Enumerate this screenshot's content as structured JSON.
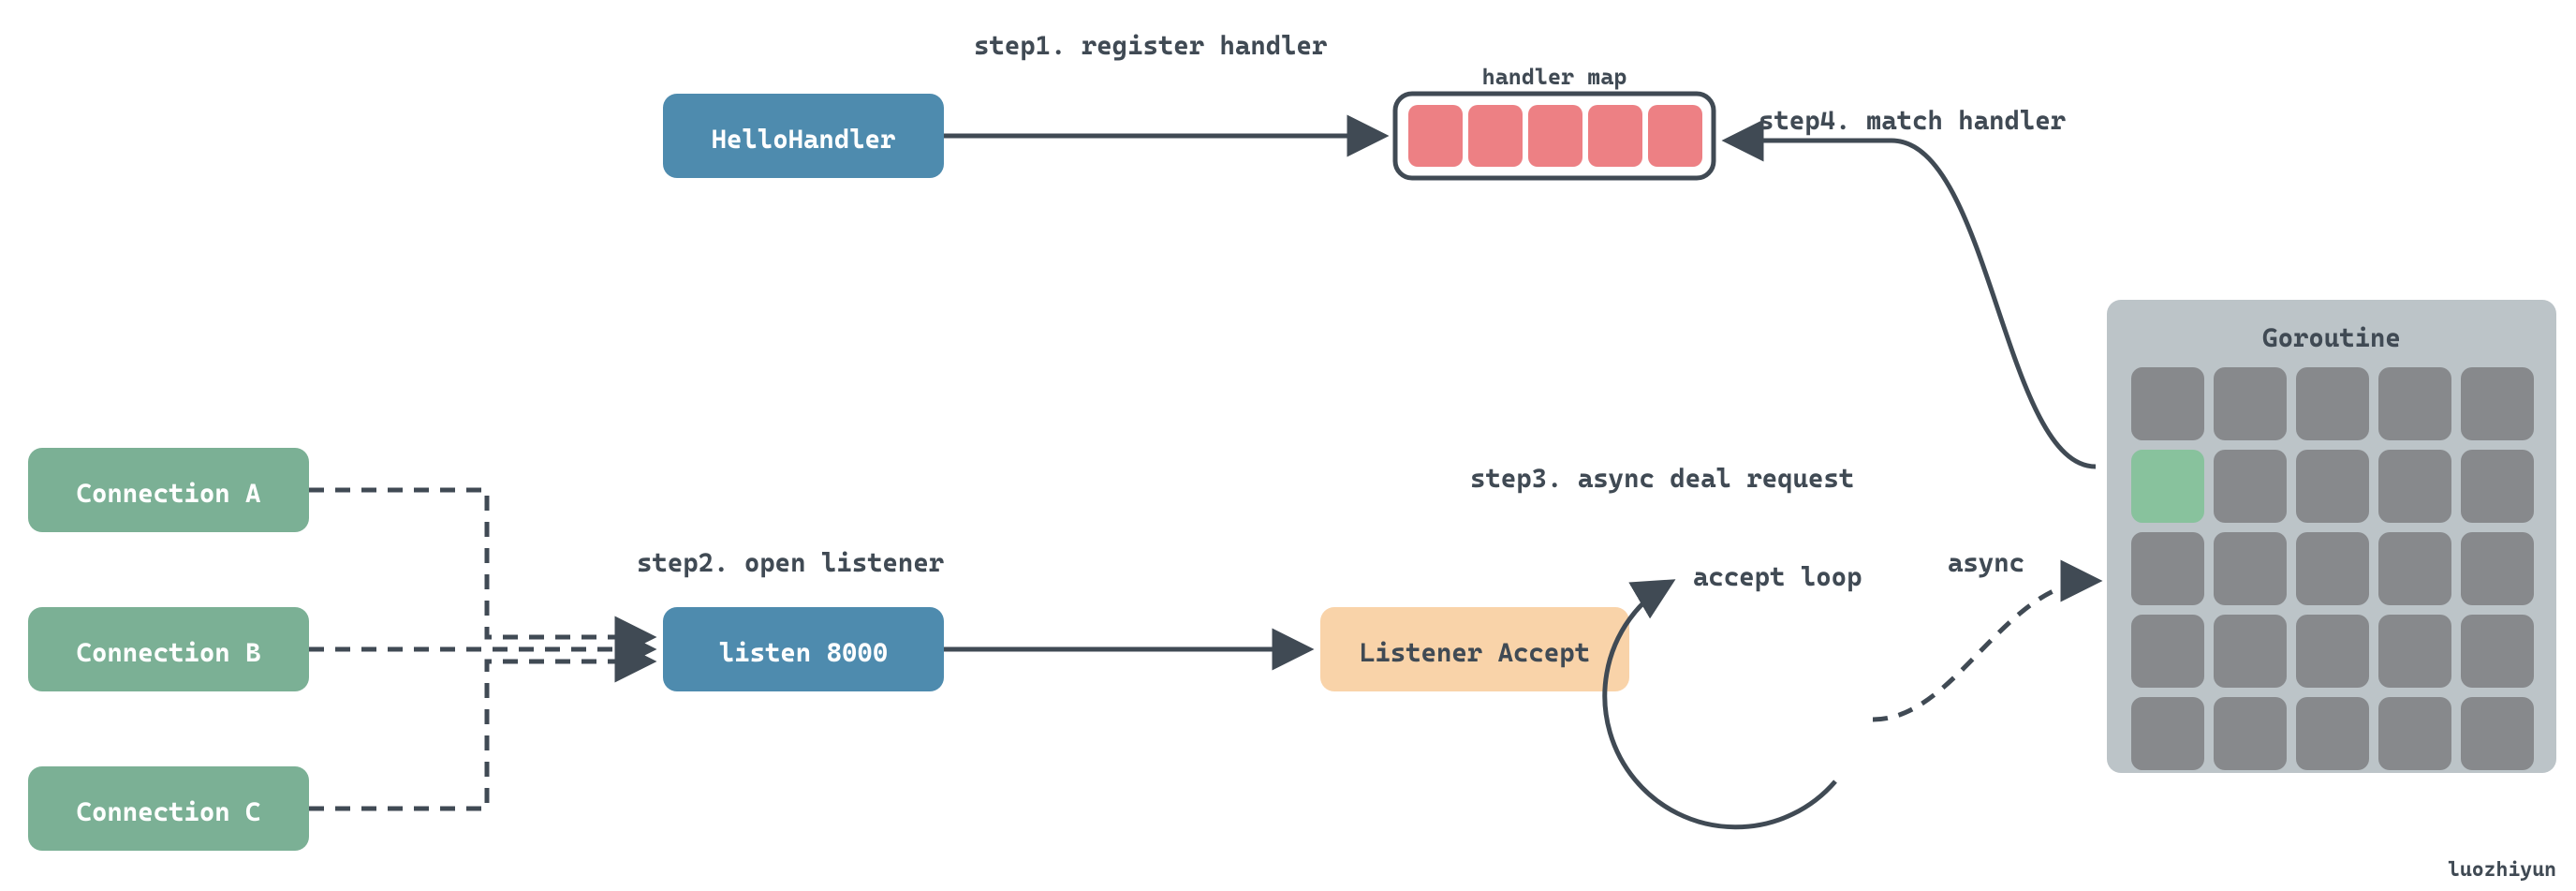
{
  "steps": {
    "s1": "step1. register handler",
    "s2": "step2. open listener",
    "s3": "step3. async deal request",
    "s4": "step4. match handler"
  },
  "boxes": {
    "hello_handler": "HelloHandler",
    "handler_map_label": "handler map",
    "conn_a": "Connection A",
    "conn_b": "Connection B",
    "conn_c": "Connection C",
    "listen": "listen 8000",
    "listener_accept": "Listener Accept",
    "goroutine": "Goroutine"
  },
  "labels": {
    "accept_loop": "accept loop",
    "async": "async"
  },
  "credit": "luozhiyun"
}
